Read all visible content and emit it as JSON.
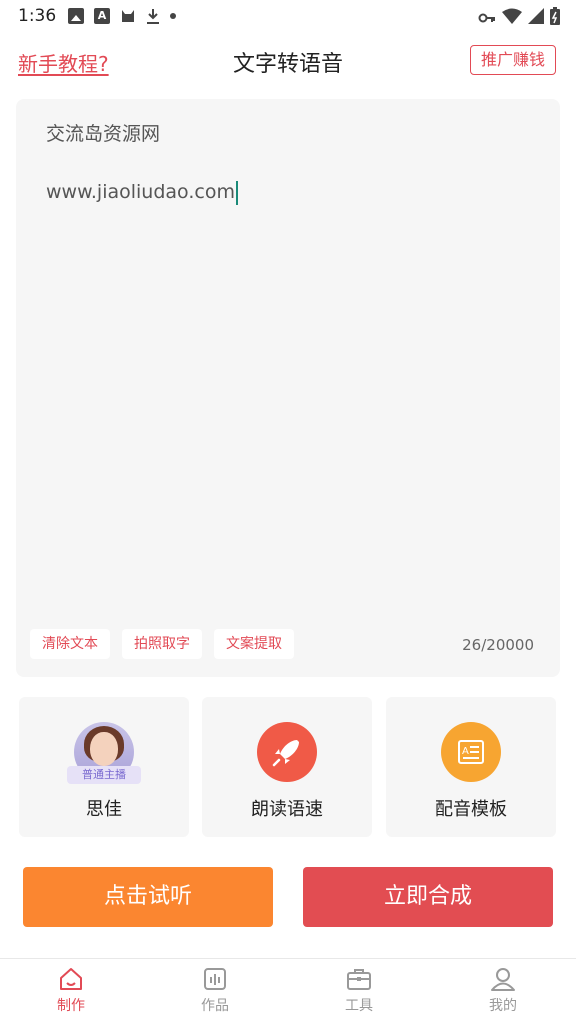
{
  "status_bar": {
    "time": "1:36",
    "left_icons": [
      "image-icon",
      "a-icon",
      "cat-icon",
      "download-icon",
      "dot-icon"
    ],
    "right_icons": [
      "key-icon",
      "wifi-icon",
      "signal-icon",
      "battery-icon"
    ]
  },
  "header": {
    "tutorial_link": "新手教程?",
    "title": "文字转语音",
    "promo_button": "推广赚钱"
  },
  "editor": {
    "line1": "交流岛资源网",
    "line2": "www.jiaoliudao.com",
    "actions": [
      "清除文本",
      "拍照取字",
      "文案提取"
    ],
    "char_count": "26/20000"
  },
  "options": [
    {
      "label": "思佳",
      "icon": "avatar",
      "tag": "普通主播"
    },
    {
      "label": "朗读语速",
      "icon": "rocket-icon"
    },
    {
      "label": "配音模板",
      "icon": "template-icon"
    }
  ],
  "buttons": {
    "listen": "点击试听",
    "synthesize": "立即合成"
  },
  "bottom_nav": [
    {
      "label": "制作",
      "icon": "home-icon",
      "active": true
    },
    {
      "label": "作品",
      "icon": "works-icon",
      "active": false
    },
    {
      "label": "工具",
      "icon": "toolbox-icon",
      "active": false
    },
    {
      "label": "我的",
      "icon": "profile-icon",
      "active": false
    }
  ],
  "colors": {
    "accent_red": "#e24a55",
    "orange": "#fb8630",
    "synth_red": "#e24d52",
    "editor_bg": "#f6f6f6"
  }
}
